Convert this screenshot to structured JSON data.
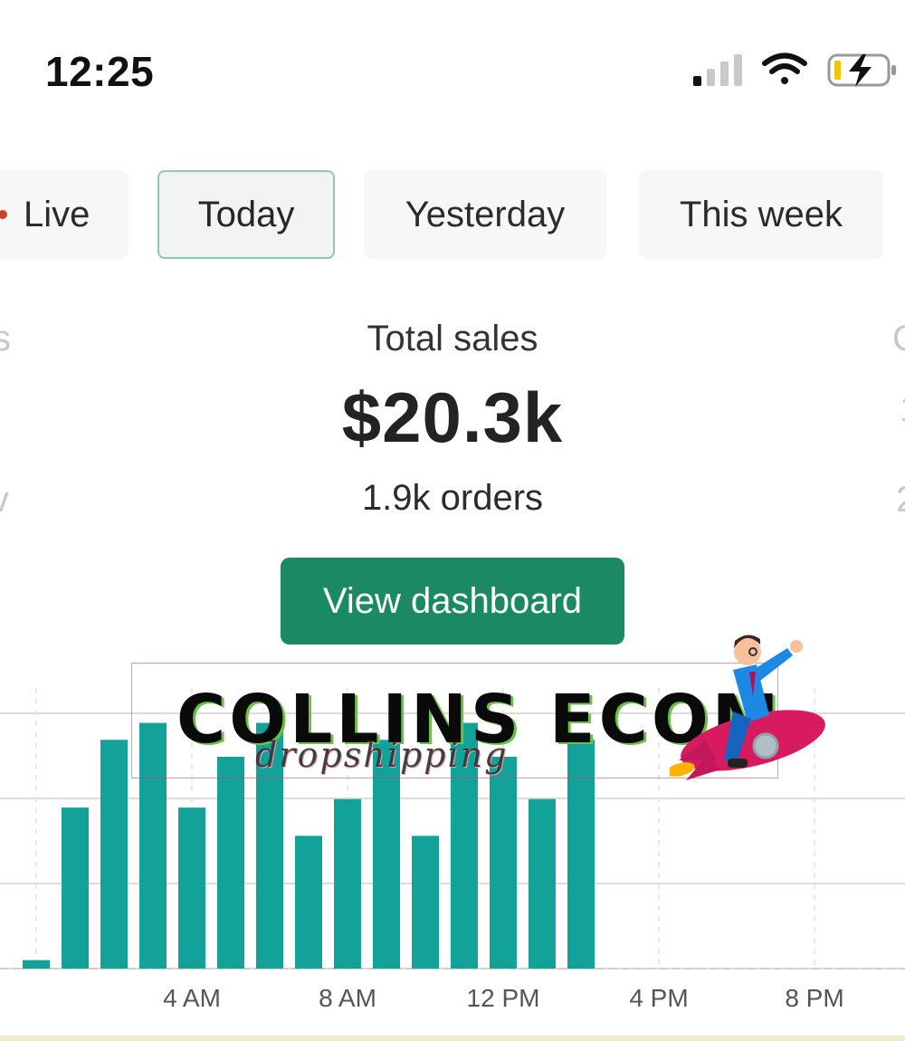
{
  "status_bar": {
    "time": "12:25"
  },
  "tabs": [
    {
      "label": "Live"
    },
    {
      "label": "Today"
    },
    {
      "label": "Yesterday"
    },
    {
      "label": "This week"
    }
  ],
  "metric": {
    "label": "Total sales",
    "value": "$20.3k",
    "sub": "1.9k orders"
  },
  "neighbors": {
    "left_label_tail": "s",
    "left_sub_tail": "v",
    "right_label_head": "C",
    "right_value_head": "1",
    "right_sub_head": "2"
  },
  "actions": {
    "view_dashboard": "View dashboard"
  },
  "watermark": {
    "title": "COLLINS ECOM",
    "subtitle": "dropshipping"
  },
  "colors": {
    "bar": "#13a29a",
    "button": "#1b8a62",
    "active_tab_border": "#8fc9ad"
  },
  "chart_data": {
    "type": "bar",
    "x_ticks": [
      "4 AM",
      "8 AM",
      "12 PM",
      "4 PM",
      "8 PM"
    ],
    "hours": [
      0,
      1,
      2,
      3,
      4,
      5,
      6,
      7,
      8,
      9,
      10,
      11,
      12,
      13,
      14
    ],
    "values": [
      3,
      57,
      81,
      87,
      57,
      75,
      87,
      47,
      60,
      81,
      47,
      87,
      75,
      60,
      81
    ],
    "ylim": [
      0,
      100
    ],
    "grid": true
  }
}
